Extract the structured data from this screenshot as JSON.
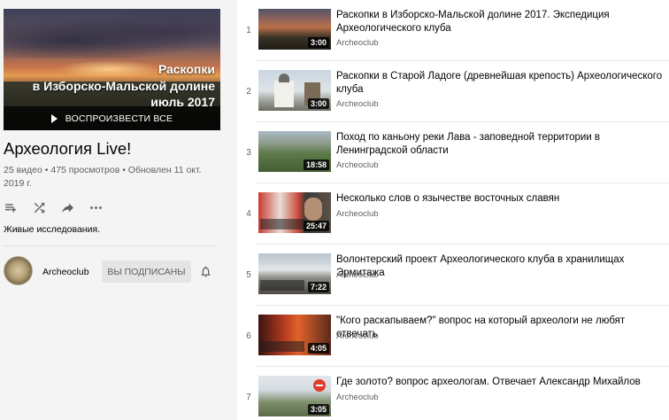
{
  "playlist": {
    "hero_lines": [
      "Раскопки",
      "в Изборско-Мальской долине",
      "июль 2017"
    ],
    "play_all_label": "ВОСПРОИЗВЕСТИ ВСЕ",
    "title": "Археология Live!",
    "stats": "25 видео • 475 просмотров • Обновлен 11 окт. 2019 г.",
    "description": "Живые исследования."
  },
  "owner": {
    "channel_name": "Archeoclub",
    "subscribe_label": "ВЫ ПОДПИСАНЫ"
  },
  "icons": {
    "add_to_queue": "playlist-add-icon",
    "shuffle": "shuffle-icon",
    "share": "share-icon",
    "more": "more-horiz-icon",
    "bell": "bell-icon",
    "play": "play-icon"
  },
  "videos": [
    {
      "index": "1",
      "title": "Раскопки в Изборско-Мальской долине 2017. Экспедиция Археологического клуба",
      "channel": "Archeoclub",
      "duration": "3:00"
    },
    {
      "index": "2",
      "title": "Раскопки в Старой Ладоге (древнейшая крепость) Археологического клуба",
      "channel": "Archeoclub",
      "duration": "3:00"
    },
    {
      "index": "3",
      "title": "Поход по каньону реки Лава - заповедной территории в Ленинградской области",
      "channel": "Archeoclub",
      "duration": "18:58"
    },
    {
      "index": "4",
      "title": "Несколько слов о язычестве восточных славян",
      "channel": "Archeoclub",
      "duration": "25:47"
    },
    {
      "index": "5",
      "title": "Волонтерский проект Археологического клуба в хранилищах Эрмитажа",
      "channel": "Archeoclub",
      "duration": "7:22"
    },
    {
      "index": "6",
      "title": "\"Кого раскапываем?\" вопрос на который археологи не любят отвечать",
      "channel": "Archeoclub",
      "duration": "4:05"
    },
    {
      "index": "7",
      "title": "Где золото? вопрос археологам. Отвечает Александр Михайлов",
      "channel": "Archeoclub",
      "duration": "3:05"
    }
  ]
}
